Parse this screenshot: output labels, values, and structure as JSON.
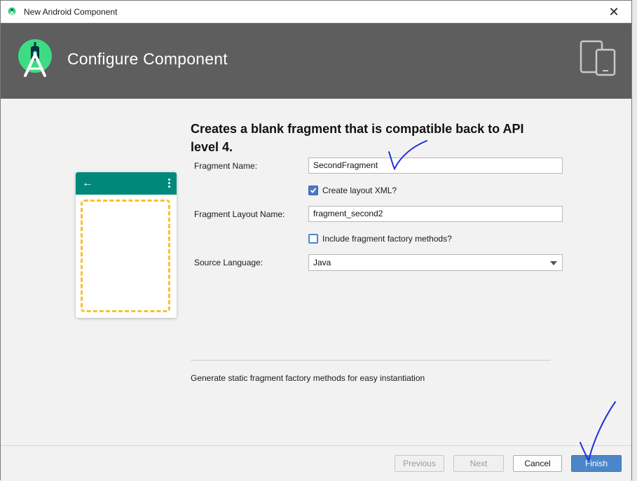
{
  "window": {
    "title": "New Android Component",
    "close_glyph": "✕"
  },
  "header": {
    "title": "Configure Component"
  },
  "content": {
    "heading": "Creates a blank fragment that is compatible back to API level 4.",
    "fragment_name": {
      "label": "Fragment Name:",
      "value": "SecondFragment"
    },
    "create_layout": {
      "label": "Create layout XML?",
      "checked": true
    },
    "layout_name": {
      "label": "Fragment Layout Name:",
      "value": "fragment_second2"
    },
    "factory_methods": {
      "label": "Include fragment factory methods?",
      "checked": false
    },
    "source_language": {
      "label": "Source Language:",
      "value": "Java"
    },
    "description": "Generate static fragment factory methods for easy instantiation"
  },
  "preview": {
    "back_glyph": "←"
  },
  "buttons": {
    "previous": "Previous",
    "next": "Next",
    "cancel": "Cancel",
    "finish": "Finish"
  },
  "colors": {
    "header_bg": "#5e5e5e",
    "app_bar": "#00897b",
    "fragment_outline": "#fbc02d",
    "logo_green": "#3ddc84",
    "primary_button": "#4a86c8",
    "pen_annotation": "#1f2fd8"
  },
  "icons": [
    "android-studio-icon",
    "android-studio-logo-icon",
    "devices-icon",
    "back-arrow-icon",
    "overflow-menu-icon",
    "checkmark-icon",
    "dropdown-arrow-icon",
    "close-icon"
  ]
}
